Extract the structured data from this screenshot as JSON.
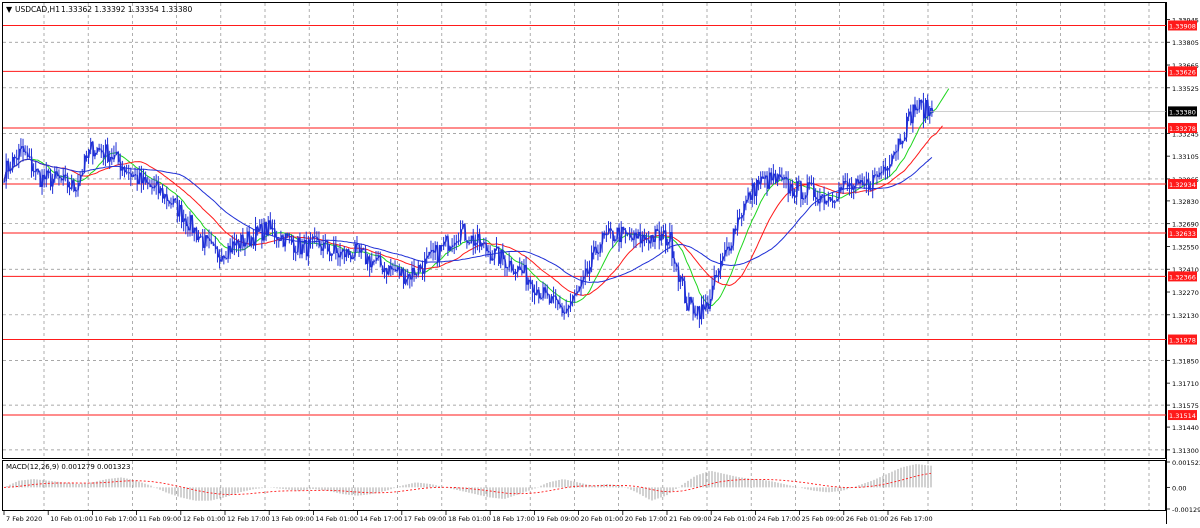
{
  "header": {
    "symbol": "USDCAD,H1",
    "ohlc": "1.33362 1.33392 1.33354 1.33380"
  },
  "macd_label": "MACD(12,26,9) 0.001279 0.001323",
  "colors": {
    "candle": "#1f2fd6",
    "hline": "#ff1a1a",
    "ma_fast": "#1fd61f",
    "ma_mid": "#ff1a1a",
    "ma_slow": "#1f2fd6",
    "grid": "#8c8c8c",
    "macd_hist": "#b4b4b4",
    "macd_signal": "#ff1a1a",
    "price_tag_bg": "#000000",
    "level_tag_bg": "#ff1a1a"
  },
  "chart_data": {
    "type": "candlestick",
    "symbol": "USDCAD",
    "timeframe": "H1",
    "ylim": [
      1.3125,
      1.3404
    ],
    "y_ticks": [
      "1.33945",
      "1.33805",
      "1.33665",
      "1.33525",
      "1.33245",
      "1.33105",
      "1.32965",
      "1.32830",
      "1.32690",
      "1.32550",
      "1.32410",
      "1.32270",
      "1.32130",
      "1.31850",
      "1.31710",
      "1.31575",
      "1.31440",
      "1.31300"
    ],
    "x_ticks": [
      "7 Feb 2020",
      "10 Feb 01:00",
      "10 Feb 17:00",
      "11 Feb 09:00",
      "12 Feb 01:00",
      "12 Feb 17:00",
      "13 Feb 09:00",
      "14 Feb 01:00",
      "14 Feb 17:00",
      "17 Feb 09:00",
      "18 Feb 01:00",
      "18 Feb 17:00",
      "19 Feb 09:00",
      "20 Feb 01:00",
      "20 Feb 17:00",
      "21 Feb 09:00",
      "24 Feb 01:00",
      "24 Feb 17:00",
      "25 Feb 09:00",
      "26 Feb 01:00",
      "26 Feb 17:00"
    ],
    "current_price": "1.33380",
    "levels": [
      "1.33908",
      "1.33626",
      "1.33278",
      "1.32934",
      "1.32633",
      "1.32366",
      "1.31978",
      "1.31514"
    ],
    "close_path": [
      1.3301,
      1.3314,
      1.3297,
      1.3296,
      1.3291,
      1.3316,
      1.3312,
      1.3302,
      1.3293,
      1.3288,
      1.3277,
      1.3263,
      1.325,
      1.3255,
      1.326,
      1.3266,
      1.326,
      1.3254,
      1.3256,
      1.325,
      1.3251,
      1.3246,
      1.3241,
      1.3237,
      1.3244,
      1.3254,
      1.3265,
      1.3257,
      1.325,
      1.3244,
      1.3235,
      1.3222,
      1.3215,
      1.323,
      1.3258,
      1.3263,
      1.3259,
      1.3261,
      1.326,
      1.3219,
      1.3215,
      1.3245,
      1.3275,
      1.3294,
      1.3296,
      1.329,
      1.3289,
      1.3285,
      1.3292,
      1.329,
      1.33,
      1.3318,
      1.3341,
      1.3338
    ],
    "macd": {
      "label": "MACD(12,26,9)",
      "main": "0.001279",
      "signal": "0.001323",
      "y_ticks": [
        "0.001523",
        "0.00",
        "-0.001298"
      ],
      "hist": [
        0.0,
        0.0004,
        0.0005,
        0.0004,
        0.0003,
        0.0002,
        0.0003,
        0.0005,
        0.0006,
        0.0004,
        0.0001,
        -0.0003,
        -0.0006,
        -0.0008,
        -0.0008,
        -0.0006,
        -0.0003,
        -0.0001,
        0.0,
        -0.0001,
        -0.0002,
        -0.0001,
        -0.0002,
        -0.0004,
        -0.0005,
        -0.0004,
        -0.0002,
        0.0001,
        0.0003,
        0.0002,
        0.0,
        -0.0002,
        -0.0004,
        -0.0006,
        -0.0007,
        -0.0004,
        -0.0001,
        0.0003,
        0.0005,
        0.0003,
        0.0001,
        0.0002,
        0.0001,
        -0.0003,
        -0.0008,
        -0.0005,
        0.0001,
        0.0007,
        0.001,
        0.0008,
        0.0006,
        0.0005,
        0.0004,
        0.0002,
        0.0,
        -0.0002,
        -0.0003,
        -0.0002,
        0.0001,
        0.0004,
        0.0008,
        0.0012,
        0.0014,
        0.0013
      ]
    }
  }
}
